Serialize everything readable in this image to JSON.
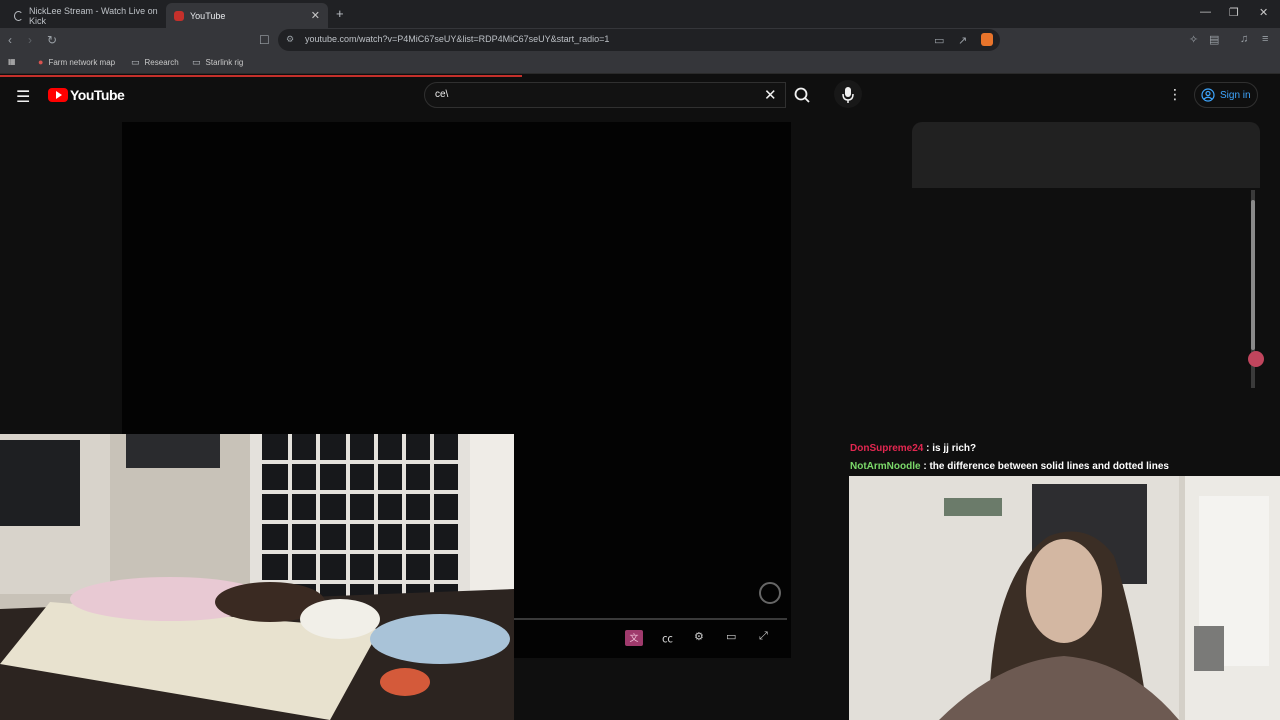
{
  "browser": {
    "tabs": [
      {
        "title": "NickLee Stream - Watch Live on Kick",
        "active": false
      },
      {
        "title": "YouTube",
        "active": true
      }
    ],
    "new_tab_label": "+",
    "address": "youtube.com/watch?v=P4MiC67seUY&list=RDP4MiC67seUY&start_radio=1",
    "bookmarks": [
      {
        "label": "Farm network map",
        "icon": "map-pin-icon"
      },
      {
        "label": "Research",
        "icon": "folder-icon"
      },
      {
        "label": "Starlink rig",
        "icon": "folder-icon"
      }
    ]
  },
  "youtube": {
    "logo_text": "YouTube",
    "search_value": "ce\\",
    "sign_in_label": "Sign in"
  },
  "chat": [
    {
      "user": "DonSupreme24",
      "message": ": is jj rich?"
    },
    {
      "user": "NotArmNoodle",
      "message": ": the difference between solid lines and dotted lines"
    }
  ],
  "colors": {
    "accent": "#ff0000",
    "link": "#3ea6ff",
    "chat_user_1": "#e22750",
    "chat_user_2": "#7bd96a"
  }
}
